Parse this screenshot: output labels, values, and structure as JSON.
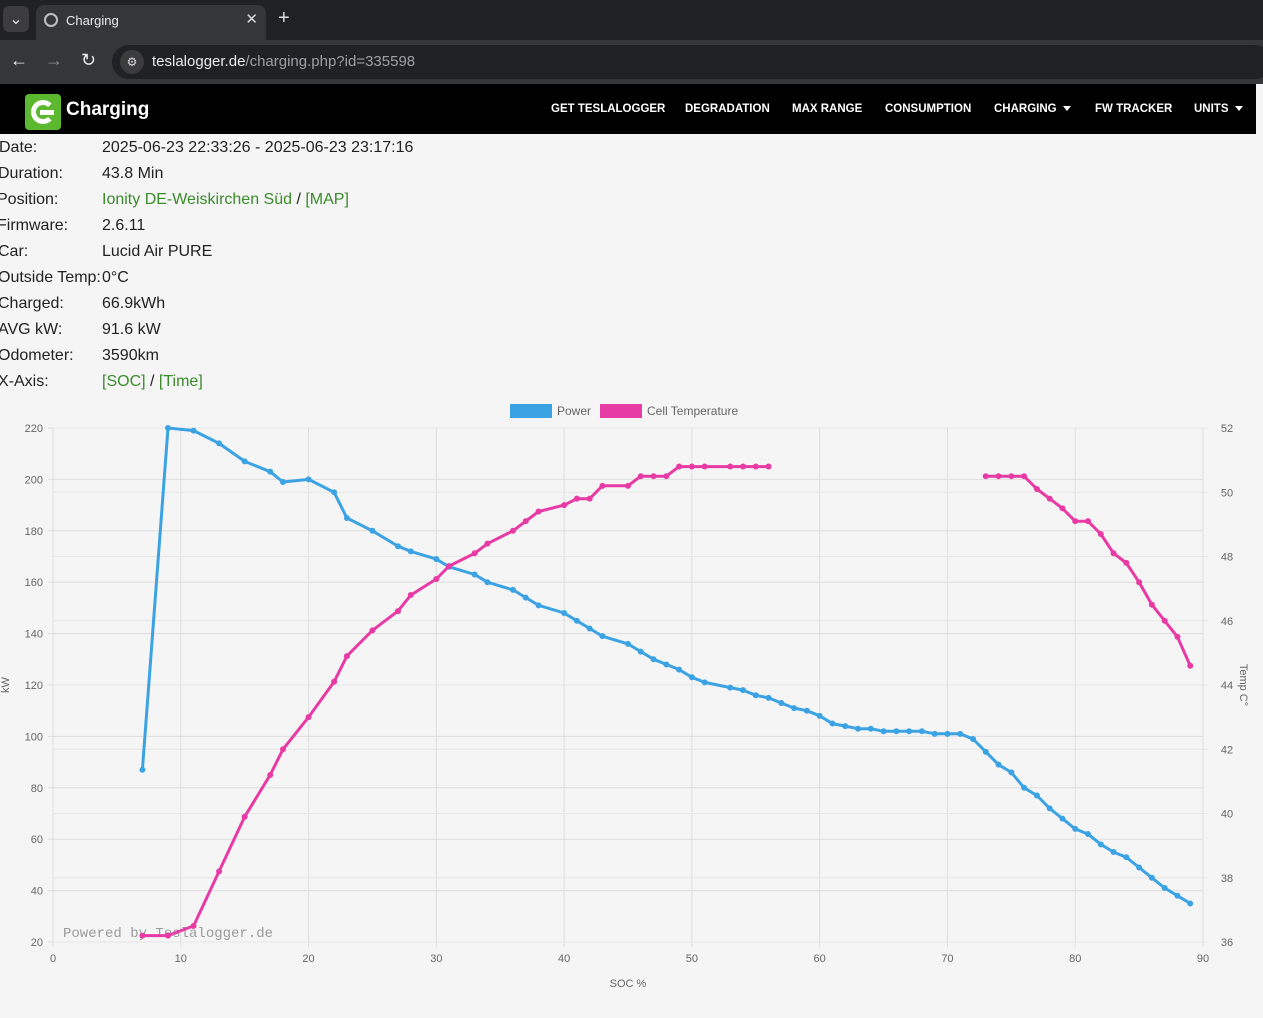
{
  "browser": {
    "tab_title": "Charging",
    "url_host": "teslalogger.de",
    "url_path": "/charging.php?id=335598"
  },
  "navbar": {
    "brand": "Charging",
    "items": [
      {
        "label": "GET TESLALOGGER",
        "dropdown": false
      },
      {
        "label": "DEGRADATION",
        "dropdown": false
      },
      {
        "label": "MAX RANGE",
        "dropdown": false
      },
      {
        "label": "CONSUMPTION",
        "dropdown": false
      },
      {
        "label": "CHARGING",
        "dropdown": true
      },
      {
        "label": "FW TRACKER",
        "dropdown": false
      },
      {
        "label": "UNITS",
        "dropdown": true
      }
    ]
  },
  "info": {
    "date_label": "Date:",
    "date": "2025-06-23 22:33:26 - 2025-06-23 23:17:16",
    "duration_label": "Duration:",
    "duration": "43.8 Min",
    "position_label": "Position:",
    "position_name": "Ionity DE-Weiskirchen Süd",
    "position_sep": " / ",
    "position_map": "[MAP]",
    "firmware_label": "Firmware:",
    "firmware": "2.6.11",
    "car_label": "Car:",
    "car": "Lucid Air PURE",
    "outside_temp_label": "Outside Temp:",
    "outside_temp": "0°C",
    "charged_label": "Charged:",
    "charged": "66.9kWh",
    "avg_kw_label": "AVG kW:",
    "avg_kw": "91.6 kW",
    "odometer_label": "Odometer:",
    "odometer": "3590km",
    "xaxis_label": "X-Axis:",
    "xaxis_soc": "[SOC]",
    "xaxis_sep": " / ",
    "xaxis_time": "[Time]"
  },
  "chart_data": {
    "type": "line",
    "xlabel": "SOC %",
    "ylabel_left": "kW",
    "ylabel_right": "Temp C°",
    "xlim": [
      0,
      90
    ],
    "ylim_left": [
      20,
      220
    ],
    "ylim_right": [
      36,
      52
    ],
    "x_ticks": [
      0,
      10,
      20,
      30,
      40,
      50,
      60,
      70,
      80,
      90
    ],
    "y_left_ticks": [
      20,
      40,
      60,
      80,
      100,
      120,
      140,
      160,
      180,
      200,
      220
    ],
    "y_right_ticks": [
      36,
      38,
      40,
      42,
      44,
      46,
      48,
      50,
      52
    ],
    "legend_position": "top-center",
    "grid": true,
    "watermark": "Powered by Teslalogger.de",
    "colors": {
      "power": "#3ba3e3",
      "temp": "#e83aa5"
    },
    "series": [
      {
        "name": "Power",
        "axis": "left",
        "x": [
          7,
          9,
          11,
          13,
          15,
          17,
          18,
          20,
          22,
          23,
          25,
          27,
          28,
          30,
          31,
          33,
          34,
          36,
          37,
          38,
          40,
          41,
          42,
          43,
          45,
          46,
          47,
          48,
          49,
          50,
          51,
          53,
          54,
          55,
          56,
          57,
          58,
          59,
          60,
          61,
          62,
          63,
          64,
          65,
          66,
          67,
          68,
          69,
          70,
          71,
          72,
          73,
          74,
          75,
          76,
          77,
          78,
          79,
          80,
          81,
          82,
          83,
          84,
          85,
          86,
          87,
          88,
          89
        ],
        "y": [
          87,
          220,
          219,
          214,
          207,
          203,
          199,
          200,
          195,
          185,
          180,
          174,
          172,
          169,
          166,
          163,
          160,
          157,
          154,
          151,
          148,
          145,
          142,
          139,
          136,
          133,
          130,
          128,
          126,
          123,
          121,
          119,
          118,
          116,
          115,
          113,
          111,
          110,
          108,
          105,
          104,
          103,
          103,
          102,
          102,
          102,
          102,
          101,
          101,
          101,
          99,
          94,
          89,
          86,
          80,
          77,
          72,
          68,
          64,
          62,
          58,
          55,
          53,
          49,
          45,
          41,
          38,
          35
        ]
      },
      {
        "name": "Cell Temperature",
        "axis": "right",
        "x": [
          7,
          9,
          11,
          13,
          15,
          17,
          18,
          20,
          22,
          23,
          25,
          27,
          28,
          30,
          31,
          33,
          34,
          36,
          37,
          38,
          40,
          41,
          42,
          43,
          45,
          46,
          47,
          48,
          49,
          50,
          51,
          53,
          54,
          55,
          56,
          73,
          74,
          75,
          76,
          77,
          78,
          79,
          80,
          81,
          82,
          83,
          84,
          85,
          86,
          87,
          88,
          89
        ],
        "y": [
          36.2,
          36.2,
          36.5,
          38.2,
          39.9,
          41.2,
          42.0,
          43.0,
          44.1,
          44.9,
          45.7,
          46.3,
          46.8,
          47.3,
          47.7,
          48.1,
          48.4,
          48.8,
          49.1,
          49.4,
          49.6,
          49.8,
          49.8,
          50.2,
          50.2,
          50.5,
          50.5,
          50.5,
          50.8,
          50.8,
          50.8,
          50.8,
          50.8,
          50.8,
          50.8,
          50.5,
          50.5,
          50.5,
          50.5,
          50.1,
          49.8,
          49.5,
          49.1,
          49.1,
          48.7,
          48.1,
          47.8,
          47.2,
          46.5,
          46.0,
          45.5,
          44.6
        ]
      }
    ]
  }
}
